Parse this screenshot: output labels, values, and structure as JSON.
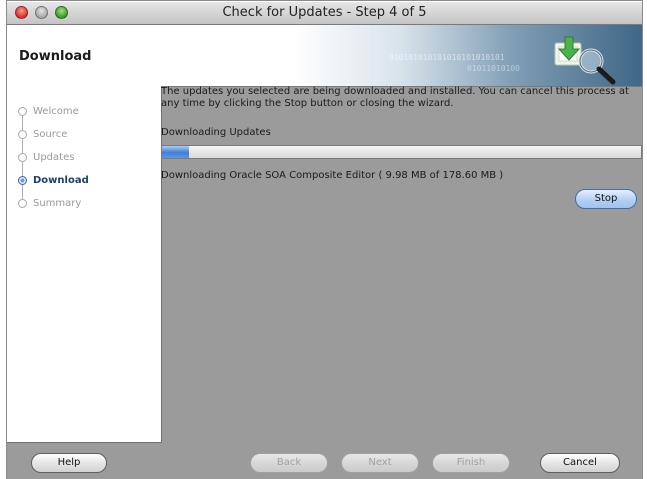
{
  "window": {
    "title": "Check for Updates - Step 4 of 5"
  },
  "header": {
    "title": "Download",
    "binary_line1": "010101010101010101010101",
    "binary_line2": "01011010100"
  },
  "steps": [
    {
      "label": "Welcome",
      "state": "done"
    },
    {
      "label": "Source",
      "state": "done"
    },
    {
      "label": "Updates",
      "state": "done"
    },
    {
      "label": "Download",
      "state": "current"
    },
    {
      "label": "Summary",
      "state": "pending"
    }
  ],
  "content": {
    "description": "The updates you selected are being downloaded and installed. You can cancel this process at any time by clicking the Stop button or closing the wizard.",
    "section_label": "Downloading Updates",
    "progress_text": "Downloading Oracle SOA Composite Editor ( 9.98 MB of 178.60 MB )",
    "progress_fraction": 0.056,
    "stop_label": "Stop"
  },
  "footer": {
    "help_label": "Help",
    "back_label": "Back",
    "next_label": "Next",
    "finish_label": "Finish",
    "cancel_label": "Cancel"
  },
  "colors": {
    "progress_fill": "#3f7fd6",
    "active_step": "#1d3e6e",
    "background": "#9b9b9b"
  },
  "icons": {
    "window_close": "close-icon",
    "window_minimize": "minimize-icon",
    "window_zoom": "zoom-icon",
    "header": "download-search-icon"
  }
}
